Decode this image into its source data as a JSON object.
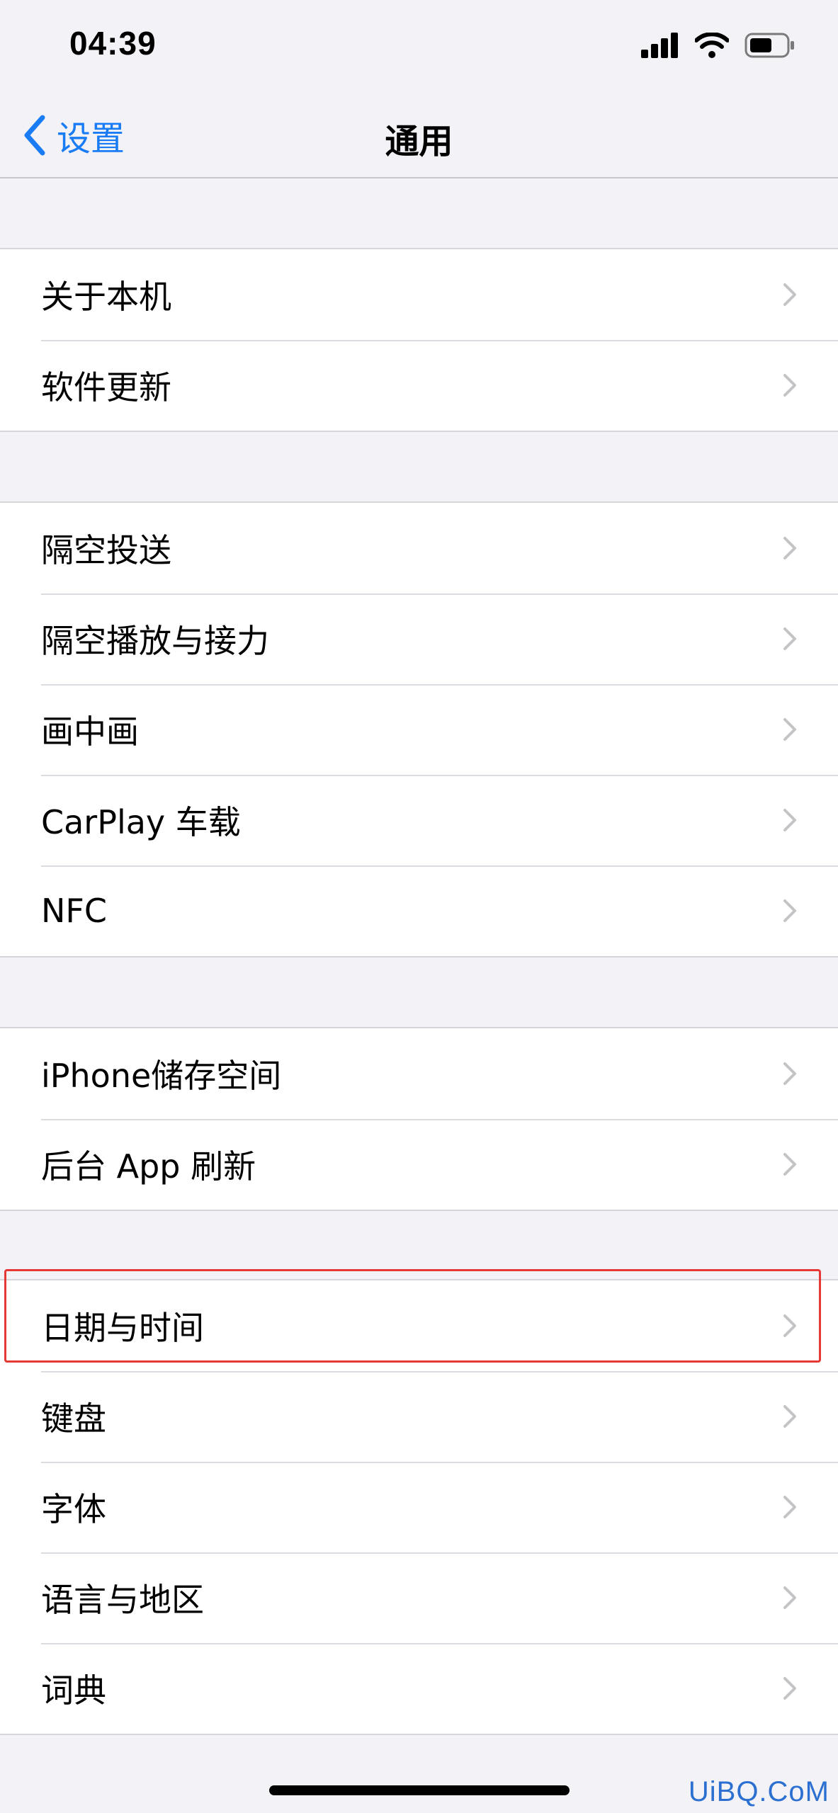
{
  "status_bar": {
    "time": "04:39",
    "icons": [
      "signal-icon",
      "wifi-icon",
      "battery-icon"
    ]
  },
  "nav": {
    "back_label": "设置",
    "title": "通用"
  },
  "groups": [
    {
      "items": [
        {
          "label": "关于本机"
        },
        {
          "label": "软件更新"
        }
      ]
    },
    {
      "items": [
        {
          "label": "隔空投送"
        },
        {
          "label": "隔空播放与接力"
        },
        {
          "label": "画中画"
        },
        {
          "label": "CarPlay 车载"
        },
        {
          "label": "NFC"
        }
      ]
    },
    {
      "items": [
        {
          "label": "iPhone储存空间"
        },
        {
          "label": "后台 App 刷新"
        }
      ]
    },
    {
      "items": [
        {
          "label": "日期与时间"
        },
        {
          "label": "键盘"
        },
        {
          "label": "字体"
        },
        {
          "label": "语言与地区"
        },
        {
          "label": "词典"
        }
      ]
    }
  ],
  "highlighted_item": "日期与时间",
  "watermark": "UiBQ.CoM",
  "colors": {
    "accent": "#1a7cf5",
    "background": "#f2f2f7",
    "highlight": "#e53935",
    "chevron": "#c4c4c7"
  }
}
